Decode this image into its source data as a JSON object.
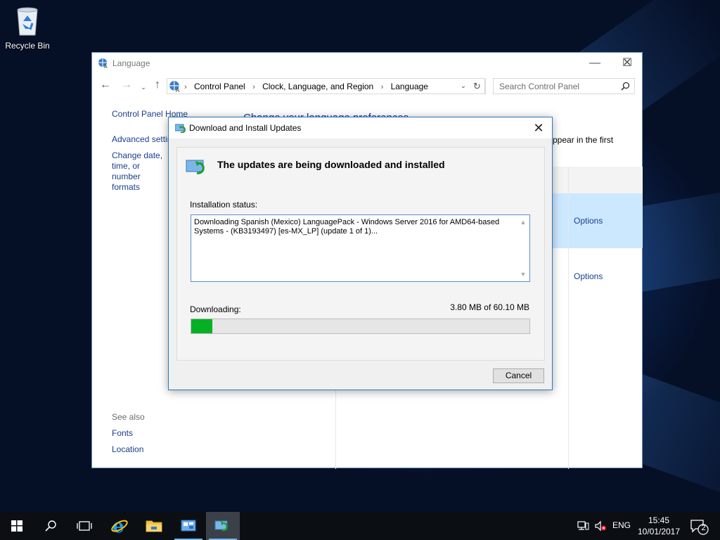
{
  "desktop": {
    "recycle_bin_label": "Recycle Bin"
  },
  "control_panel": {
    "title": "Language",
    "breadcrumbs": [
      "Control Panel",
      "Clock, Language, and Region",
      "Language"
    ],
    "search_placeholder": "Search Control Panel",
    "left_nav": {
      "home": "Control Panel Home",
      "advanced": "Advanced settings",
      "date_time": "Change date, time, or number formats"
    },
    "main_heading": "Change your language preferences",
    "description_fragment": "ppear in the first",
    "options_links": [
      "Options",
      "Options"
    ],
    "see_also": {
      "title": "See also",
      "links": [
        "Fonts",
        "Location"
      ]
    }
  },
  "dialog": {
    "title": "Download and Install Updates",
    "heading": "The updates are being downloaded and installed",
    "status_label": "Installation status:",
    "status_text": "Downloading Spanish (Mexico) LanguagePack - Windows Server 2016 for AMD64-based Systems - (KB3193497) [es-MX_LP] (update 1 of 1)...",
    "downloading_label": "Downloading:",
    "download_amount": "3.80 MB of 60.10 MB",
    "progress_fraction": 0.063,
    "cancel_label": "Cancel"
  },
  "taskbar": {
    "language": "ENG",
    "time": "15:45",
    "date": "10/01/2017",
    "notification_count": "2"
  },
  "colors": {
    "progress_green": "#06b025",
    "link_blue": "#1a3e8c",
    "selection_blue": "#cce8ff",
    "dialog_border": "#2b79c2"
  }
}
